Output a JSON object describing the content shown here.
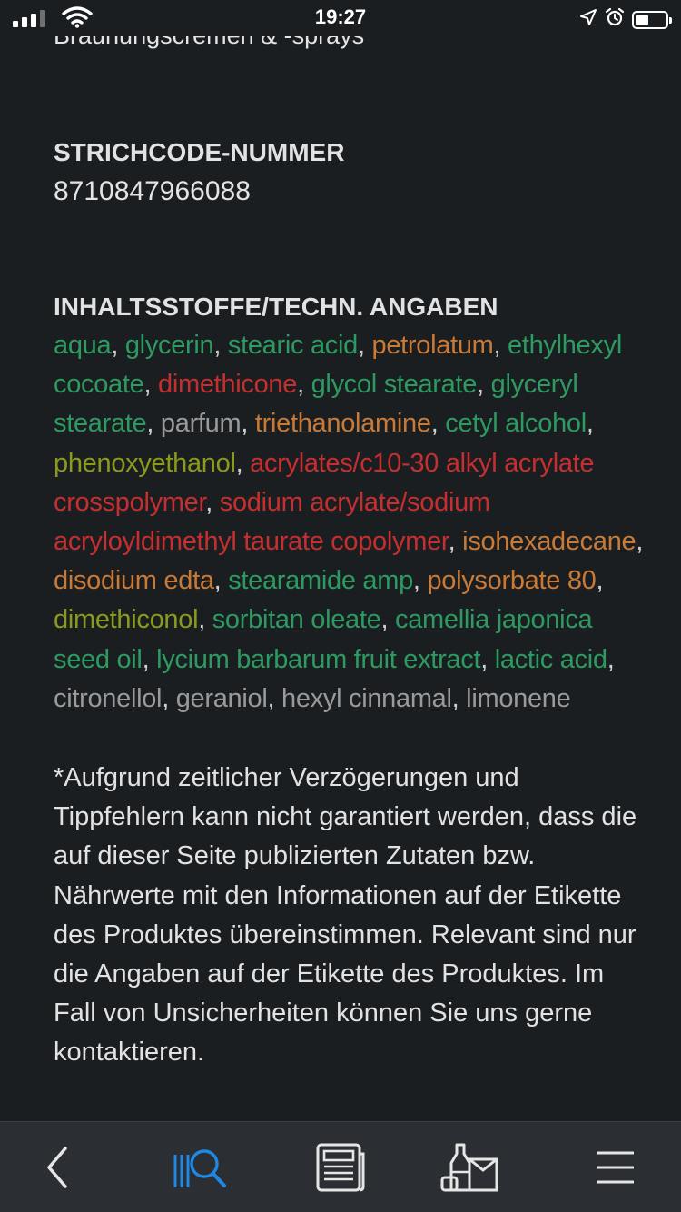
{
  "status_bar": {
    "time": "19:27"
  },
  "product": {
    "category_cut": "Bräunungscremen & -sprays",
    "barcode_heading": "STRICHCODE-NUMMER",
    "barcode_value": "8710847966088",
    "ingredients_heading": "INHALTSSTOFFE/TECHN. ANGABEN",
    "ingredients": [
      {
        "name": "aqua",
        "rating": "green"
      },
      {
        "name": "glycerin",
        "rating": "green"
      },
      {
        "name": "stearic acid",
        "rating": "green"
      },
      {
        "name": "petrolatum",
        "rating": "orange"
      },
      {
        "name": "ethylhexyl cocoate",
        "rating": "green"
      },
      {
        "name": "dimethicone",
        "rating": "red"
      },
      {
        "name": "glycol stearate",
        "rating": "green"
      },
      {
        "name": "glyceryl stearate",
        "rating": "green"
      },
      {
        "name": "parfum",
        "rating": "gray"
      },
      {
        "name": "triethanolamine",
        "rating": "orange"
      },
      {
        "name": "cetyl alcohol",
        "rating": "green"
      },
      {
        "name": "phenoxyethanol",
        "rating": "olive"
      },
      {
        "name": "acrylates/c10-30 alkyl acrylate crosspolymer",
        "rating": "red"
      },
      {
        "name": "sodium acrylate/sodium acryloyldimethyl taurate copolymer",
        "rating": "red"
      },
      {
        "name": "isohexadecane",
        "rating": "orange"
      },
      {
        "name": "disodium edta",
        "rating": "orange"
      },
      {
        "name": "stearamide amp",
        "rating": "green"
      },
      {
        "name": "polysorbate 80",
        "rating": "orange"
      },
      {
        "name": "dimethiconol",
        "rating": "olive"
      },
      {
        "name": "sorbitan oleate",
        "rating": "green"
      },
      {
        "name": "camellia japonica seed oil",
        "rating": "green"
      },
      {
        "name": "lycium barbarum fruit extract",
        "rating": "green"
      },
      {
        "name": "lactic acid",
        "rating": "green"
      },
      {
        "name": "citronellol",
        "rating": "gray"
      },
      {
        "name": "geraniol",
        "rating": "gray"
      },
      {
        "name": "hexyl cinnamal",
        "rating": "gray"
      },
      {
        "name": "limonene",
        "rating": "gray"
      }
    ],
    "disclaimer": "*Aufgrund zeitlicher Verzögerungen und Tippfehlern kann nicht garantiert werden, dass die auf dieser Seite publizierten Zutaten bzw. Nährwerte mit den Informationen auf der Etikette des Produktes übereinstimmen. Relevant sind nur die Angaben auf der Etikette des Produktes. Im Fall von Unsicherheiten können Sie uns gerne kontaktieren."
  },
  "rating_colors": {
    "green": "#2d9a61",
    "orange": "#c97a36",
    "red": "#c62f2f",
    "olive": "#8a9a1c",
    "gray": "#9a9a9a"
  },
  "tab_bar": {
    "active_color": "#1e88e5",
    "tabs": [
      {
        "icon": "chevron-left-icon",
        "active": false
      },
      {
        "icon": "scan-search-icon",
        "active": true
      },
      {
        "icon": "newspaper-icon",
        "active": false
      },
      {
        "icon": "products-icon",
        "active": false
      },
      {
        "icon": "menu-icon",
        "active": false
      }
    ]
  },
  "battery_level": 0.45
}
